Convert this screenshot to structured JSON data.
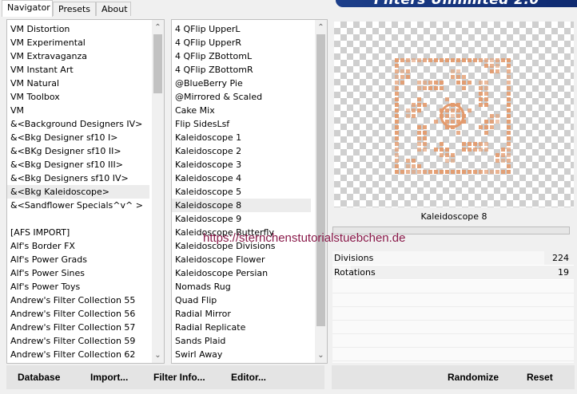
{
  "tabs": [
    {
      "label": "Navigator",
      "active": true
    },
    {
      "label": "Presets",
      "active": false
    },
    {
      "label": "About",
      "active": false
    }
  ],
  "banner_title": "Filters Unlimited 2.0",
  "categories": [
    "VM Distortion",
    "VM Experimental",
    "VM Extravaganza",
    "VM Instant Art",
    "VM Natural",
    "VM Toolbox",
    "VM",
    "&<Background Designers IV>",
    "&<Bkg Designer sf10 I>",
    "&<BKg Designer sf10 II>",
    "&<Bkg Designer sf10 III>",
    "&<Bkg Designers sf10 IV>",
    "&<Bkg Kaleidoscope>",
    "&<Sandflower Specials^v^ >",
    "",
    "[AFS IMPORT]",
    "Alf's Border FX",
    "Alf's Power Grads",
    "Alf's Power Sines",
    "Alf's Power Toys",
    "Andrew's Filter Collection 55",
    "Andrew's Filter Collection 56",
    "Andrew's Filter Collection 57",
    "Andrew's Filter Collection 59",
    "Andrew's Filter Collection 62"
  ],
  "selected_category": "&<Bkg Kaleidoscope>",
  "filters": [
    "4 QFlip UpperL",
    "4 QFlip UpperR",
    "4 QFlip ZBottomL",
    "4 QFlip ZBottomR",
    "@BlueBerry Pie",
    "@Mirrored & Scaled",
    "Cake Mix",
    "Flip SidesLsf",
    "Kaleidoscope 1",
    "Kaleidoscope 2",
    "Kaleidoscope 3",
    "Kaleidoscope 4",
    "Kaleidoscope 5",
    "Kaleidoscope 8",
    "Kaleidoscope 9",
    "Kaleidoscope Butterfly",
    "Kaleidoscope Divisions",
    "Kaleidoscope Flower",
    "Kaleidoscope Persian",
    "Nomads Rug",
    "Quad Flip",
    "Radial Mirror",
    "Radial Replicate",
    "Sands Plaid",
    "Swirl Away"
  ],
  "selected_filter": "Kaleidoscope 8",
  "preview_label": "Kaleidoscope 8",
  "params": [
    {
      "label": "Divisions",
      "value": "224",
      "fraction": 0.878
    },
    {
      "label": "Rotations",
      "value": "19",
      "fraction": 0.075
    }
  ],
  "watermark": "https://sternchenstutorialstuebchen.de",
  "buttons": {
    "database": "Database",
    "import": "Import...",
    "filter_info": "Filter Info...",
    "editor": "Editor...",
    "randomize": "Randomize",
    "reset": "Reset"
  },
  "colors": {
    "pattern": "#e39a6c",
    "banner": "#1d3f8a"
  }
}
